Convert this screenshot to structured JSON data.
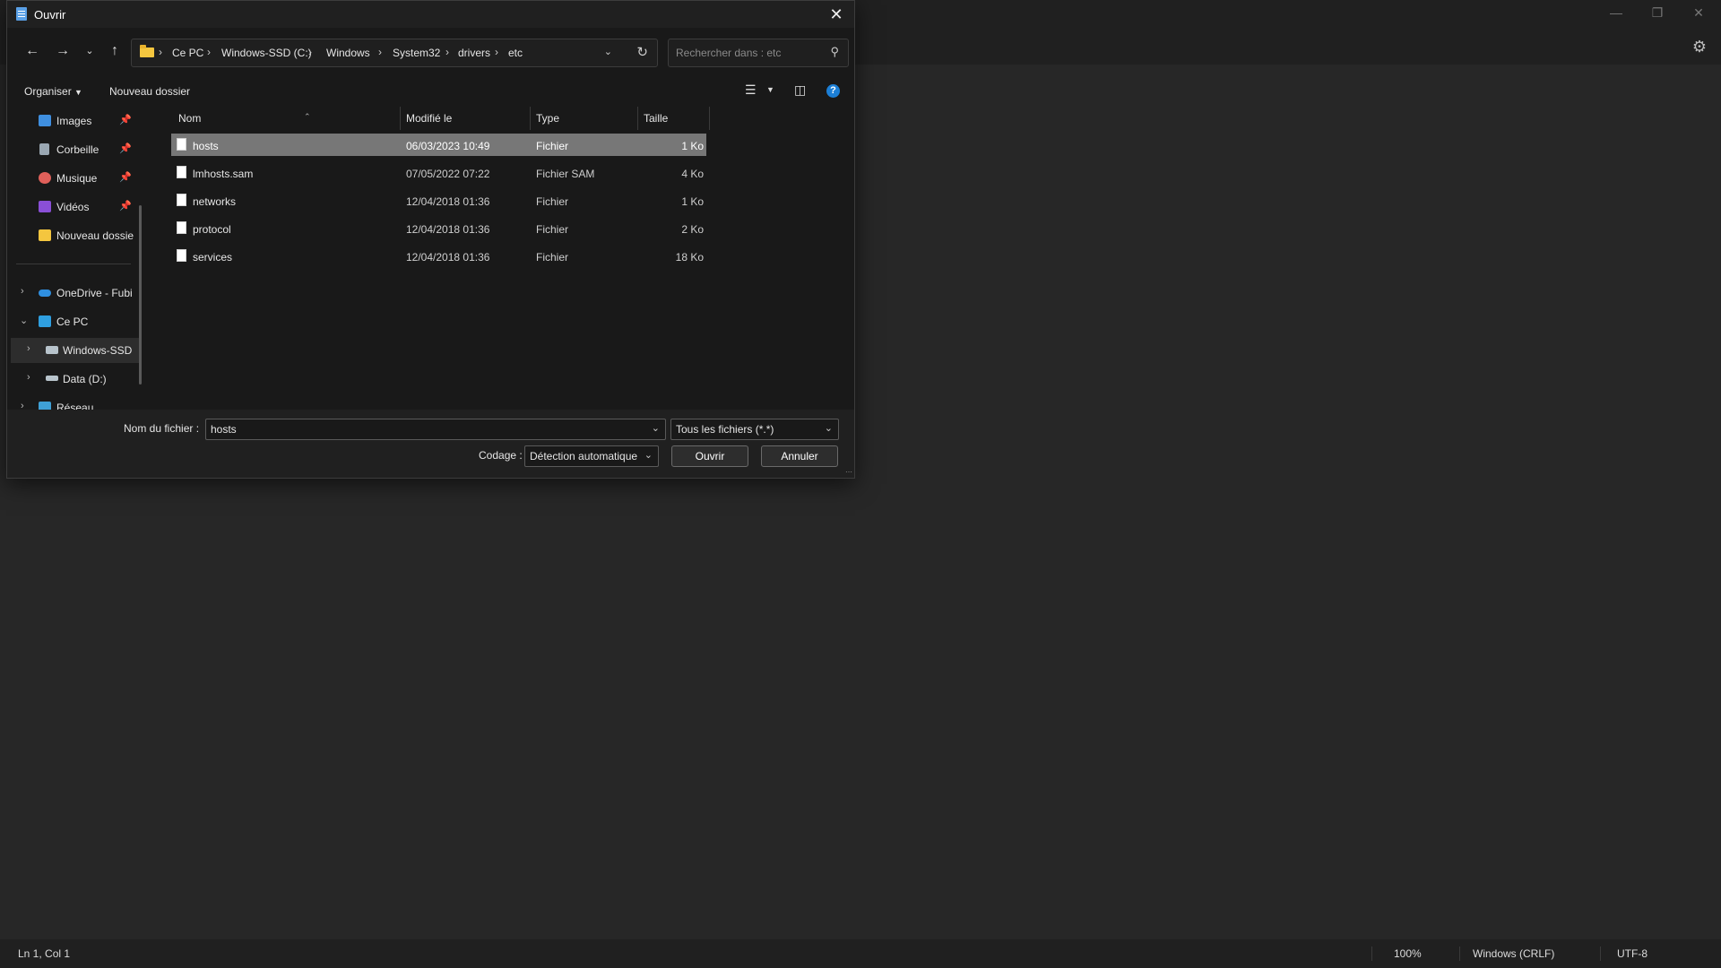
{
  "app": {
    "status": {
      "position": "Ln 1, Col 1",
      "zoom": "100%",
      "line_ending": "Windows (CRLF)",
      "encoding": "UTF-8"
    },
    "icons": {
      "minimize": "minimize-icon",
      "maximize": "maximize-icon",
      "close": "close-icon",
      "settings": "gear-icon"
    }
  },
  "dialog": {
    "title": "Ouvrir",
    "breadcrumb": [
      "Ce PC",
      "Windows-SSD (C:)",
      "Windows",
      "System32",
      "drivers",
      "etc"
    ],
    "search_placeholder": "Rechercher dans : etc",
    "toolbar": {
      "organize": "Organiser",
      "new_folder": "Nouveau dossier"
    },
    "nav": [
      {
        "label": "Images",
        "icon": "images-icon",
        "pinned": true
      },
      {
        "label": "Corbeille",
        "icon": "recycle-bin-icon",
        "pinned": true
      },
      {
        "label": "Musique",
        "icon": "music-icon",
        "pinned": true
      },
      {
        "label": "Vidéos",
        "icon": "videos-icon",
        "pinned": true
      },
      {
        "label": "Nouveau dossie",
        "icon": "folder-icon",
        "pinned": false
      },
      {
        "label": "OneDrive - Fubi",
        "icon": "cloud-icon"
      },
      {
        "label": "Ce PC",
        "icon": "computer-icon"
      },
      {
        "label": "Windows-SSD",
        "icon": "drive-icon",
        "selected": true
      },
      {
        "label": "Data (D:)",
        "icon": "drive-icon"
      },
      {
        "label": "Réseau",
        "icon": "network-icon"
      }
    ],
    "columns": {
      "name": "Nom",
      "modified": "Modifié le",
      "type": "Type",
      "size": "Taille"
    },
    "files": [
      {
        "name": "hosts",
        "modified": "06/03/2023 10:49",
        "type": "Fichier",
        "size": "1 Ko",
        "selected": true
      },
      {
        "name": "lmhosts.sam",
        "modified": "07/05/2022 07:22",
        "type": "Fichier SAM",
        "size": "4 Ko"
      },
      {
        "name": "networks",
        "modified": "12/04/2018 01:36",
        "type": "Fichier",
        "size": "1 Ko"
      },
      {
        "name": "protocol",
        "modified": "12/04/2018 01:36",
        "type": "Fichier",
        "size": "2 Ko"
      },
      {
        "name": "services",
        "modified": "12/04/2018 01:36",
        "type": "Fichier",
        "size": "18 Ko"
      }
    ],
    "filename_label": "Nom du fichier :",
    "filename_value": "hosts",
    "filter_value": "Tous les fichiers  (*.*)",
    "encoding_label": "Codage :",
    "encoding_value": "Détection automatique",
    "open_button": "Ouvrir",
    "cancel_button": "Annuler"
  }
}
